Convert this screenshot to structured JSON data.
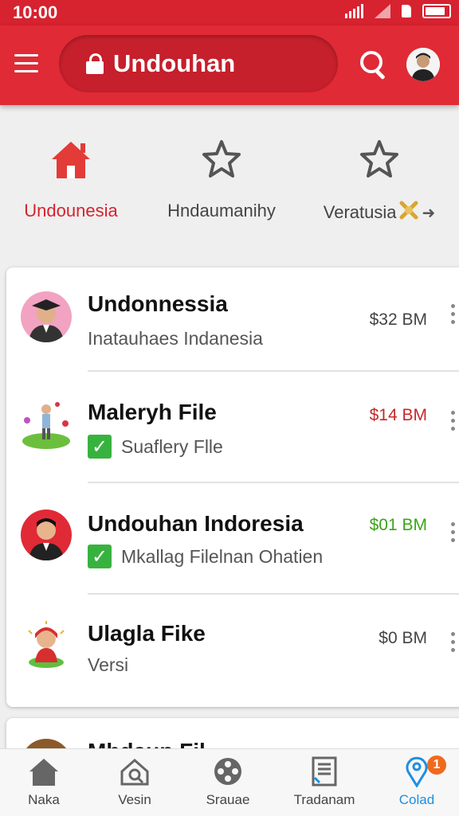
{
  "status_bar": {
    "time": "10:00"
  },
  "app_bar": {
    "title": "Undouhan"
  },
  "tabs": [
    {
      "label": "Undounesia",
      "icon": "home-icon",
      "active": true
    },
    {
      "label": "Hndaumanihy",
      "icon": "star-icon",
      "active": false
    },
    {
      "label": "Veratusia",
      "icon": "star-icon",
      "active": false
    }
  ],
  "items": [
    {
      "name": "Undonnessia",
      "subtitle": "Inatauhaes Indanesia",
      "price": "$32 BM",
      "price_color": "#444444",
      "checked": false
    },
    {
      "name": "Maleryh File",
      "subtitle": "Suaflery Flle",
      "price": "$14 BM",
      "price_color": "#c62828",
      "checked": true
    },
    {
      "name": "Undouhan Indoresia",
      "subtitle": "Mkallag Filelnan Ohatien",
      "price": "$01 BM",
      "price_color": "#3aa51a",
      "checked": true
    },
    {
      "name": "Ulagla Fike",
      "subtitle": "Versi",
      "price": "$0 BM",
      "price_color": "#444444",
      "checked": false
    }
  ],
  "partial_item": {
    "name": "Mhdaup Fil"
  },
  "bottom_nav": [
    {
      "label": "Naka",
      "icon": "home-icon"
    },
    {
      "label": "Vesin",
      "icon": "house-search-icon"
    },
    {
      "label": "Srauae",
      "icon": "film-reel-icon"
    },
    {
      "label": "Tradanam",
      "icon": "document-list-icon"
    },
    {
      "label": "Colad",
      "icon": "location-pin-icon",
      "active": true,
      "badge": "1"
    }
  ],
  "colors": {
    "primary": "#e02a36",
    "status_bar": "#d7222f",
    "active_nav": "#1e8fe0",
    "check": "#38b23f"
  }
}
